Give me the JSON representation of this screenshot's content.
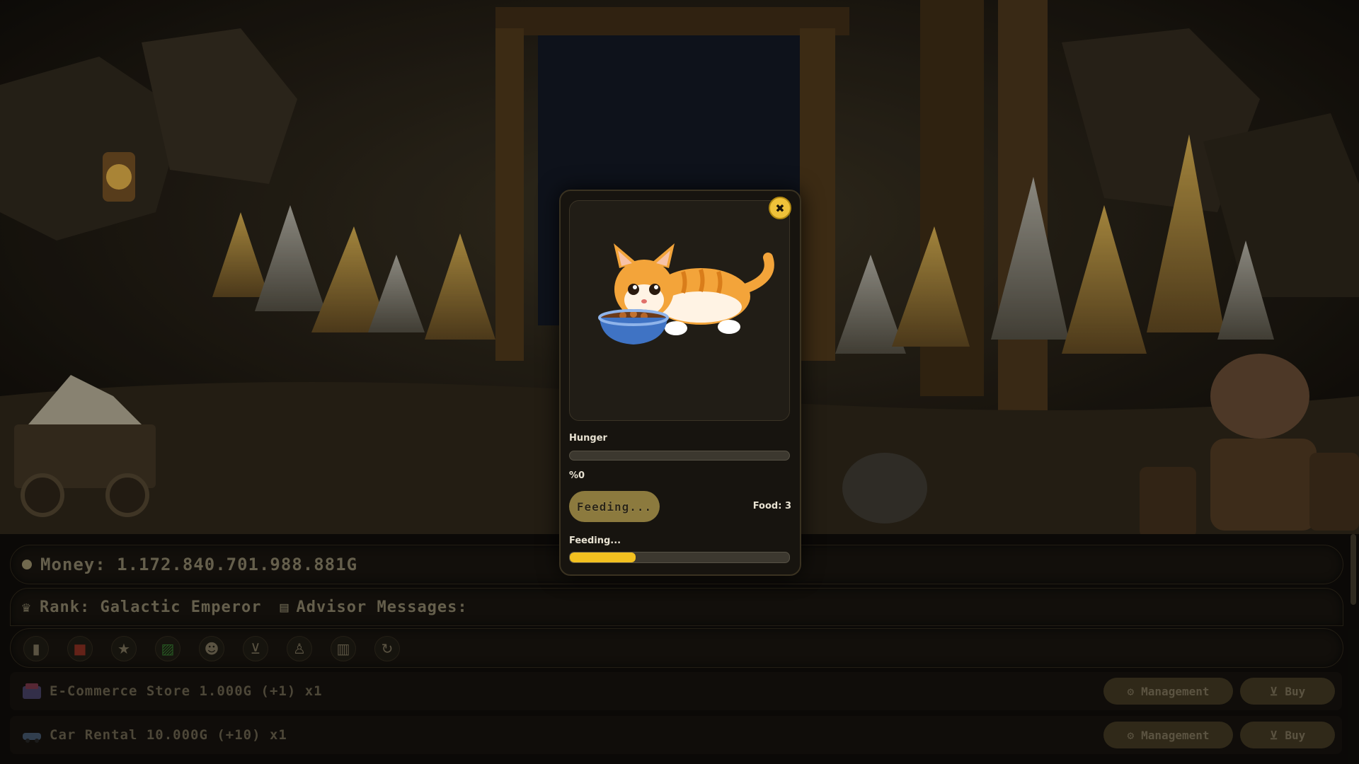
{
  "hud": {
    "money": "Money: 1.172.840.701.988.881G",
    "rank": "Rank: Galactic Emperor",
    "advisor": "Advisor Messages:",
    "toolbar_icons": [
      "book-icon",
      "gift-icon",
      "star-icon",
      "chart-icon",
      "cat-icon",
      "cart-icon",
      "person-icon",
      "building-icon",
      "refresh-icon"
    ]
  },
  "businesses": [
    {
      "label": "E-Commerce Store 1.000G (+1) x1",
      "manage": "Management",
      "buy": "Buy"
    },
    {
      "label": "Car Rental 10.000G (+10) x1",
      "manage": "Management",
      "buy": "Buy"
    }
  ],
  "modal": {
    "hunger_label": "Hunger",
    "hunger_value_text": "%0",
    "hunger_fraction": 0,
    "feed_button": "Feeding...",
    "food_count": "Food: 3",
    "progress_label": "Feeding...",
    "progress_fraction": 0.3,
    "close_symbol": "✖"
  },
  "colors": {
    "accent_gold": "#f2c020",
    "panel": "#17140f",
    "hud_text": "#7c745d"
  }
}
